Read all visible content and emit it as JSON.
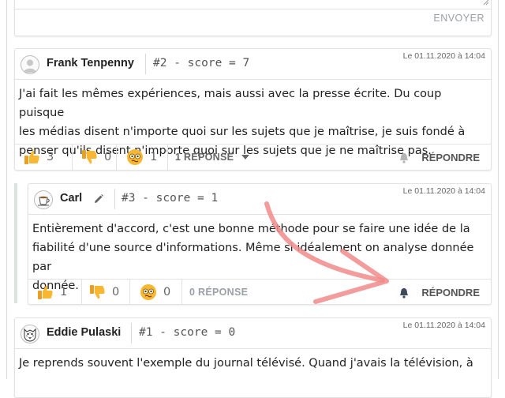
{
  "reply_form": {
    "send_label": "ENVOYER"
  },
  "comments": [
    {
      "author": "Frank Tenpenny",
      "score_text": "#2 - score = 7",
      "date": "Le 01.11.2020 à 14:04",
      "avatar_icon": "user-avatar-icon",
      "body_lines": [
        "J'ai fait les mêmes expériences, mais aussi avec la presse écrite. Du coup puisque",
        "les médias disent n'importe quoi sur les sujets que je maîtrise, je suis fondé à",
        "penser qu'ils disent n'importe quoi sur les sujets que je ne maîtrise pas."
      ],
      "reactions": {
        "thumbs_up": "3",
        "thumbs_down": "0",
        "confused": "1"
      },
      "replies_label": "1 RÉPONSE",
      "answer_label": "RÉPONDRE"
    },
    {
      "author": "Carl",
      "score_text": "#3 - score = 1",
      "date": "Le 01.11.2020 à 14:04",
      "avatar_icon": "coffee-cup-avatar-icon",
      "body_lines": [
        "Entièrement d'accord, c'est une bonne méthode pour se faire une idée de la",
        "fiabilité d'une source d'informations. Même si idéalement on analyse donnée par",
        "donnée."
      ],
      "reactions": {
        "thumbs_up": "1",
        "thumbs_down": "0",
        "confused": "0"
      },
      "replies_label": "0 RÉPONSE",
      "answer_label": "RÉPONDRE"
    },
    {
      "author": "Eddie Pulaski",
      "score_text": "#1 - score = 0",
      "date": "Le 01.11.2020 à 14:04",
      "avatar_icon": "tiger-avatar-icon",
      "body_lines": [
        "Je reprends souvent l'exemple du journal télévisé. Quand j'avais la télévision, à"
      ]
    }
  ],
  "colors": {
    "accent_arrow": "#f08b8b",
    "thread_bar": "#dbe3dd",
    "emoji_yellow": "#f7b733"
  }
}
